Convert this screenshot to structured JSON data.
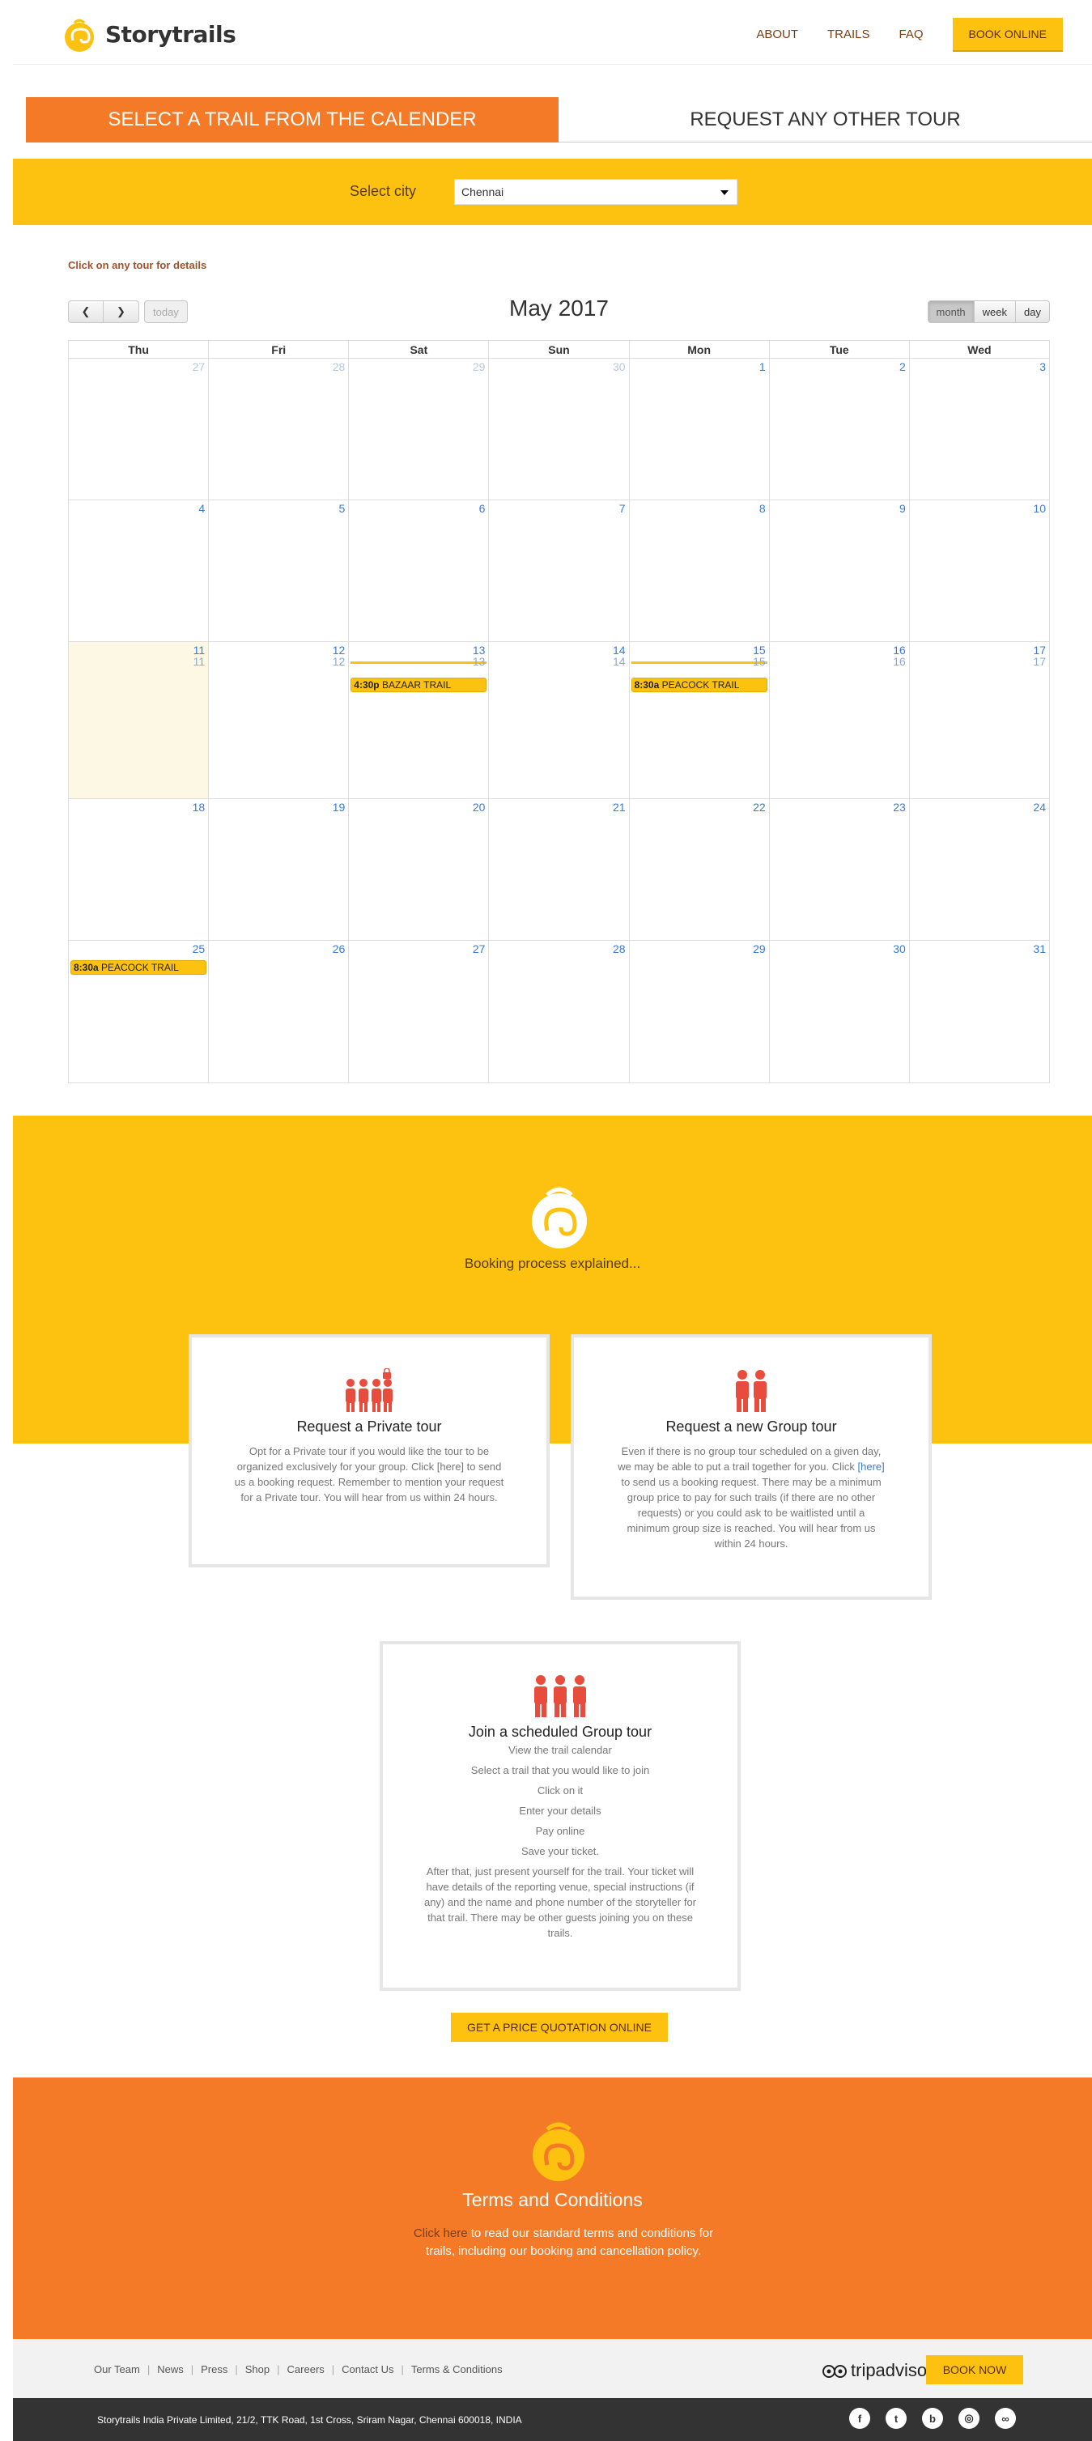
{
  "brand": {
    "name": "Storytrails",
    "accent": "#fcc20f",
    "orange": "#f47a28"
  },
  "nav": {
    "about": "ABOUT",
    "trails": "TRAILS",
    "faq": "FAQ",
    "book_online": "BOOK ONLINE"
  },
  "tabs": {
    "active": "SELECT A TRAIL FROM THE CALENDER",
    "other": "REQUEST ANY OTHER TOUR"
  },
  "city": {
    "label": "Select city",
    "value": "Chennai"
  },
  "hint": "Click on any tour for details",
  "calendar": {
    "today_label": "today",
    "title": "May 2017",
    "views": [
      "month",
      "week",
      "day"
    ],
    "active_view": "month",
    "weekdays": [
      "Thu",
      "Fri",
      "Sat",
      "Sun",
      "Mon",
      "Tue",
      "Wed"
    ],
    "weeks": [
      [
        "27",
        "28",
        "29",
        "30",
        "1",
        "2",
        "3"
      ],
      [
        "4",
        "5",
        "6",
        "7",
        "8",
        "9",
        "10"
      ],
      [
        "11",
        "12",
        "13",
        "14",
        "15",
        "16",
        "17"
      ],
      [
        "18",
        "19",
        "20",
        "21",
        "22",
        "23",
        "24"
      ],
      [
        "25",
        "26",
        "27",
        "28",
        "29",
        "30",
        "31"
      ]
    ],
    "events": {
      "bazaar_time": "4:30p",
      "bazaar_name": "BAZAAR TRAIL",
      "peacock1_time": "8:30a",
      "peacock1_name": "PEACOCK TRAIL",
      "peacock2_time": "8:30a",
      "peacock2_name": "PEACOCK TRAIL"
    }
  },
  "booking": {
    "caption": "Booking process explained...",
    "private": {
      "title": "Request a Private tour",
      "text": "Opt for a Private tour if you would like the tour to be organized exclusively for your group. Click [here] to send us a booking request. Remember to mention your request for a Private tour. You will hear from us within 24 hours."
    },
    "group": {
      "title": "Request a new Group tour",
      "text_before": "Even if there is no group tour scheduled on a given day, we may be able to put a trail together for you. Click ",
      "link": "[here]",
      "text_after": " to send us a booking request. There may be a minimum group price to pay for such trails (if there are no other requests) or you could ask to be waitlisted until a minimum group size is reached. You will hear from us within 24 hours."
    },
    "scheduled": {
      "title": "Join a scheduled Group tour",
      "steps": [
        "View the trail calendar",
        "Select a trail that you would like to join",
        "Click on it",
        "Enter your details",
        "Pay online",
        "Save your ticket."
      ],
      "text": "After that, just present yourself for the trail. Your ticket will have details of the reporting venue, special instructions (if any) and the name and phone number of the storyteller for that trail. There may be other guests joining you on these trails."
    },
    "quote_button": "GET A PRICE QUOTATION ONLINE"
  },
  "terms": {
    "title": "Terms and Conditions",
    "link": "Click here",
    "text": " to read our standard terms and conditions for trails, including our booking and cancellation policy."
  },
  "footer": {
    "links": [
      "Our Team",
      "News",
      "Press",
      "Shop",
      "Careers",
      "Contact Us",
      "Terms & Conditions"
    ],
    "tripadvisor": "tripadvisor",
    "book_now": "BOOK NOW",
    "address": "Storytrails India Private Limited, 21/2, TTK Road, 1st Cross, Sriram Nagar, Chennai 600018, INDIA",
    "social": [
      {
        "icon": "facebook-icon",
        "glyph": "f"
      },
      {
        "icon": "twitter-icon",
        "glyph": "t"
      },
      {
        "icon": "blogger-icon",
        "glyph": "b"
      },
      {
        "icon": "instagram-icon",
        "glyph": "◎"
      },
      {
        "icon": "tripadvisor-icon",
        "glyph": "∞"
      }
    ]
  }
}
